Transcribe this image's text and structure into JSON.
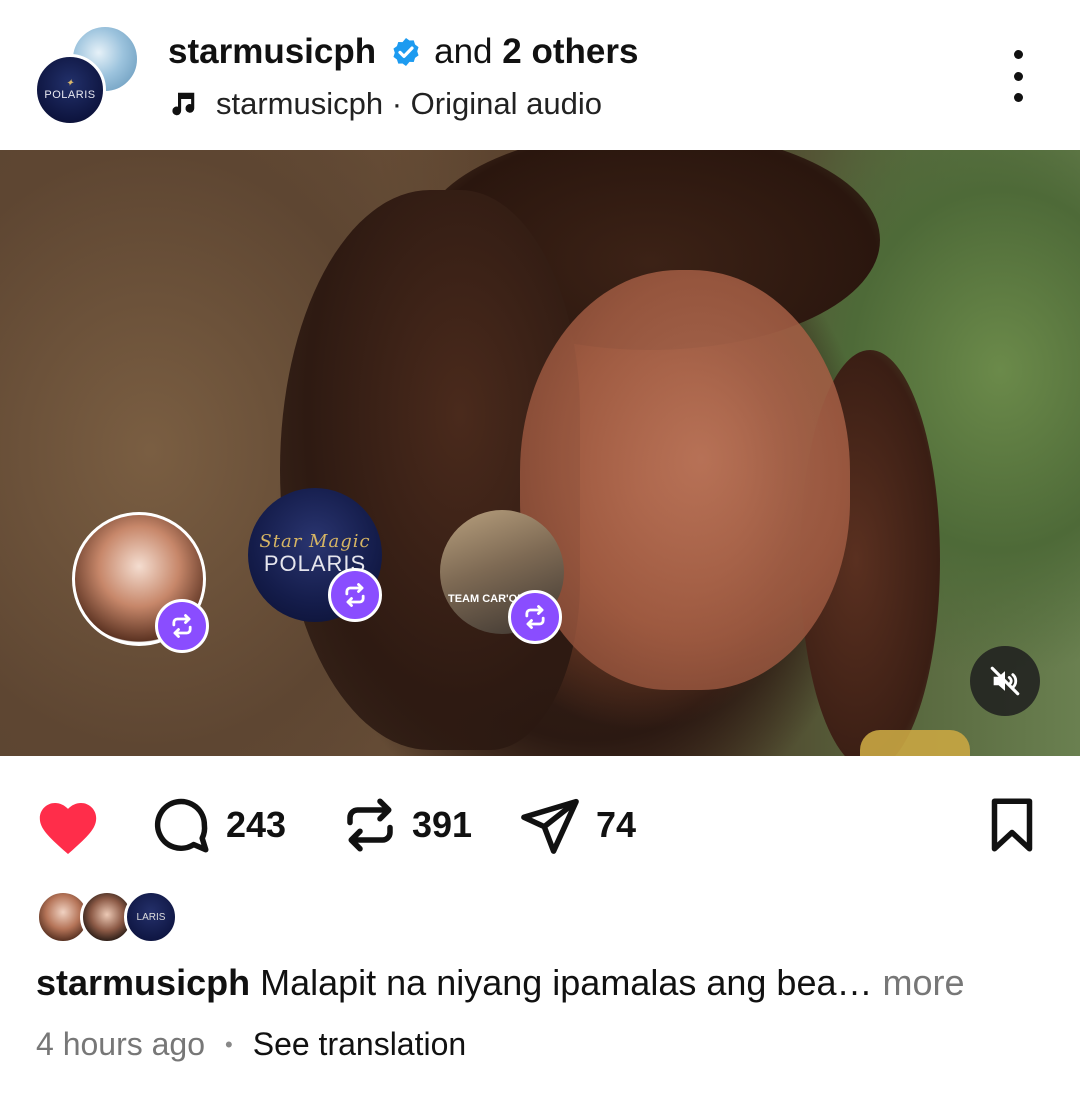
{
  "header": {
    "username": "starmusicph",
    "and_text": "and",
    "others_text": "2 others",
    "audio_label": "starmusicph · Original audio",
    "avatar_text": "POLARIS"
  },
  "media": {
    "repost_avatars": [
      {
        "name": "person"
      },
      {
        "text": "POLARIS",
        "script": "Star Magic"
      },
      {
        "text": "TEAM CAR'ON OFF"
      }
    ],
    "mute_state": "muted"
  },
  "actions": {
    "liked": true,
    "comments": "243",
    "reposts": "391",
    "shares": "74"
  },
  "likers": {
    "third_text": "LARIS"
  },
  "caption": {
    "username": "starmusicph",
    "text": "Malapit na niyang ipamalas ang bea…",
    "more_label": "more"
  },
  "meta": {
    "time_ago": "4 hours ago",
    "separator": "•",
    "translate_label": "See translation"
  },
  "colors": {
    "like": "#ff2d4a",
    "repost_badge": "#8a4dff",
    "verified": "#1d9bf0",
    "muted_text": "#777777"
  }
}
